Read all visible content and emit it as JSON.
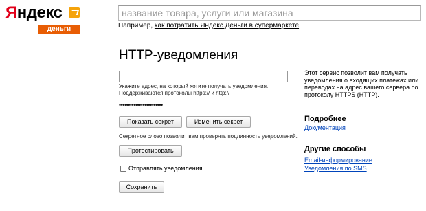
{
  "logo": {
    "word_first": "Я",
    "word_rest": "ндекс",
    "sub": "деньги"
  },
  "search": {
    "placeholder": "название товара, услуги или магазина",
    "hint_prefix": "Например, ",
    "hint_link": "как потратить Яндекс.Деньги в супермаркете"
  },
  "main": {
    "title": "HTTP-уведомления",
    "url_value": "",
    "url_hint_line1": "Укажите адрес, на который хотите получать уведомления.",
    "url_hint_line2": "Поддерживаются протоколы https:// и http://",
    "secret_masked": "••••••••••••••••••••••••",
    "show_secret_label": "Показать секрет",
    "change_secret_label": "Изменить секрет",
    "secret_hint": "Секретное слово позволит вам проверять подлинность уведомлений.",
    "test_label": "Протестировать",
    "send_notifications_label": "Отправлять уведомления",
    "send_notifications_checked": false,
    "save_label": "Сохранить"
  },
  "aside": {
    "description": "Этот сервис позволит вам получать уведомления о входящих платежах или переводах на адрес вашего сервера по протоколу HTTPS (HTTP).",
    "more_heading": "Подробнее",
    "docs_link": "Документация",
    "other_heading": "Другие способы",
    "email_link": "Email-информирование",
    "sms_link": "Уведомления по SMS"
  },
  "colors": {
    "brand_red": "#e2001a",
    "logo_orange": "#e85d04",
    "link": "#0044bb"
  }
}
